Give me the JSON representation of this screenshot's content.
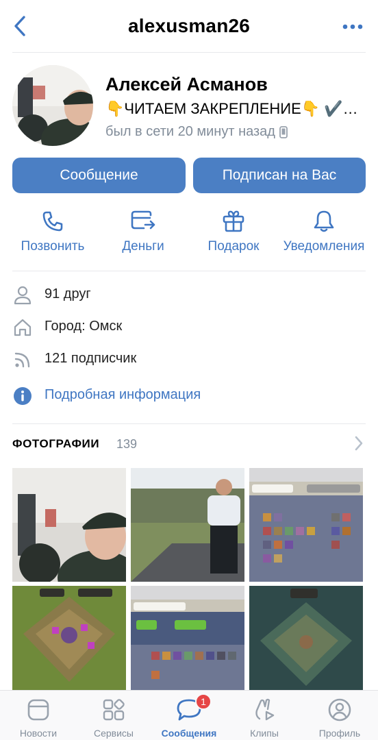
{
  "topbar": {
    "title": "alexusman26"
  },
  "profile": {
    "name": "Алексей Асманов",
    "status": "👇ЧИТАЕМ ЗАКРЕПЛЕНИЕ👇 ✔️…",
    "online": "был в сети 20 минут назад",
    "online_device_icon": "phone-icon"
  },
  "buttons": {
    "message": "Сообщение",
    "follow": "Подписан на Вас"
  },
  "actions": [
    {
      "label": "Позвонить",
      "icon": "phone-call-icon"
    },
    {
      "label": "Деньги",
      "icon": "money-transfer-icon"
    },
    {
      "label": "Подарок",
      "icon": "gift-icon"
    },
    {
      "label": "Уведомления",
      "icon": "bell-icon"
    }
  ],
  "info": {
    "friends": "91 друг",
    "city": "Город: Омск",
    "followers": "121 подписчик",
    "details": "Подробная информация"
  },
  "photos": {
    "title": "ФОТОГРАФИИ",
    "count": "139"
  },
  "tabbar": {
    "items": [
      {
        "label": "Новости",
        "icon": "news-icon"
      },
      {
        "label": "Сервисы",
        "icon": "services-icon"
      },
      {
        "label": "Сообщения",
        "icon": "messages-icon",
        "badge": "1"
      },
      {
        "label": "Клипы",
        "icon": "clips-icon"
      },
      {
        "label": "Профиль",
        "icon": "profile-icon"
      }
    ],
    "active": "Сообщения"
  },
  "colors": {
    "accent": "#4b7fc4",
    "link": "#3f76c2",
    "muted": "#818c99",
    "badge": "#e64646"
  }
}
